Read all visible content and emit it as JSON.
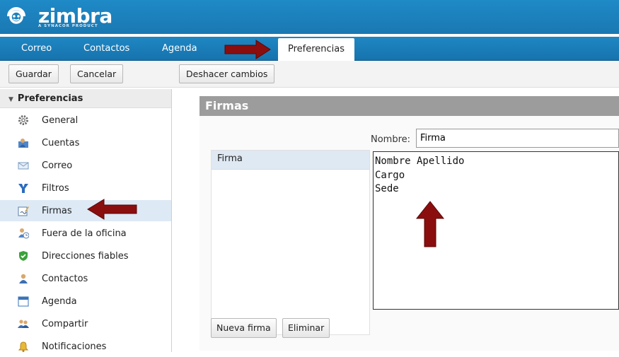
{
  "app": {
    "logo_text": "zimbra",
    "logo_subtitle": "A SYNACOR PRODUCT",
    "brand_color": "#1a7fbf"
  },
  "tabs": [
    {
      "label": "Correo"
    },
    {
      "label": "Contactos"
    },
    {
      "label": "Agenda"
    },
    {
      "label": "Preferencias",
      "active": true
    }
  ],
  "toolbar": {
    "save_label": "Guardar",
    "cancel_label": "Cancelar",
    "undo_label": "Deshacer cambios"
  },
  "sidebar": {
    "header": "Preferencias",
    "items": [
      {
        "label": "General",
        "icon": "gear-icon"
      },
      {
        "label": "Cuentas",
        "icon": "accounts-icon"
      },
      {
        "label": "Correo",
        "icon": "mail-icon"
      },
      {
        "label": "Filtros",
        "icon": "filter-icon"
      },
      {
        "label": "Firmas",
        "icon": "signature-icon",
        "selected": true
      },
      {
        "label": "Fuera de la oficina",
        "icon": "out-of-office-icon"
      },
      {
        "label": "Direcciones fiables",
        "icon": "trusted-shield-icon"
      },
      {
        "label": "Contactos",
        "icon": "contact-icon"
      },
      {
        "label": "Agenda",
        "icon": "calendar-icon"
      },
      {
        "label": "Compartir",
        "icon": "share-icon"
      },
      {
        "label": "Notificaciones",
        "icon": "bell-icon"
      }
    ]
  },
  "signatures": {
    "title": "Firmas",
    "name_label": "Nombre:",
    "name_value": "Firma",
    "list": [
      {
        "label": "Firma"
      }
    ],
    "body": "Nombre Apellido\nCargo\nSede",
    "new_label": "Nueva firma",
    "delete_label": "Eliminar"
  },
  "annotation_color": "#8b0e0e"
}
